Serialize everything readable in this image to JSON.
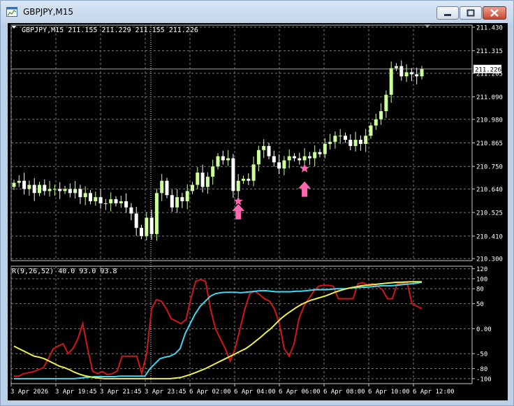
{
  "window": {
    "title": "GBPJPY,M15",
    "buttons": [
      "minimize",
      "maximize",
      "close"
    ]
  },
  "colors": {
    "background": "#000000",
    "grid": "#7a7a7a",
    "candle_bull": "#ccff99",
    "candle_bear": "#ffffff",
    "axis_text": "#ffffff",
    "rsi_red": "#d01818",
    "rsi_cyan": "#40d8f0",
    "rsi_yellow": "#f0f050",
    "signal_pink": "#ff66b0"
  },
  "chart_data": [
    {
      "type": "candlestick",
      "header": "GBPJPY,M15  211.155 211.229 211.155 211.226",
      "current_price_label": "211.226",
      "current_price": 211.226,
      "y_ticks": [
        "211.430",
        "211.315",
        "211.205",
        "211.090",
        "210.980",
        "210.865",
        "210.750",
        "210.640",
        "210.525",
        "210.410",
        "210.300"
      ],
      "ylim": [
        210.29,
        211.44
      ],
      "close": [
        210.67,
        210.68,
        210.64,
        210.66,
        210.62,
        210.66,
        210.63,
        210.64,
        210.64,
        210.63,
        210.64,
        210.62,
        210.64,
        210.6,
        210.62,
        210.58,
        210.6,
        210.57,
        210.57,
        210.59,
        210.57,
        210.58,
        210.55,
        210.52,
        210.45,
        210.41,
        210.5,
        210.42,
        210.62,
        210.68,
        210.61,
        210.55,
        210.6,
        210.58,
        210.63,
        210.66,
        210.72,
        210.65,
        210.7,
        210.75,
        210.8,
        210.78,
        210.79,
        210.63,
        210.68,
        210.69,
        210.68,
        210.76,
        210.83,
        210.85,
        210.8,
        210.77,
        210.74,
        210.78,
        210.8,
        210.79,
        210.78,
        210.8,
        210.79,
        210.82,
        210.81,
        210.86,
        210.87,
        210.9,
        210.9,
        210.88,
        210.85,
        210.88,
        210.86,
        210.9,
        210.95,
        210.98,
        211.02,
        211.1,
        211.23,
        211.24,
        211.19,
        211.21,
        211.2,
        211.19,
        211.226
      ],
      "signals": [
        {
          "type": "buy-arrow",
          "candle": 44,
          "price": 210.56
        },
        {
          "type": "star",
          "candle": 44,
          "price": 210.58
        },
        {
          "type": "buy-arrow",
          "candle": 57,
          "price": 210.67
        },
        {
          "type": "star",
          "candle": 57,
          "price": 210.74
        }
      ]
    },
    {
      "type": "line",
      "header": "R(9,26,52) 40.0 93.0 93.8",
      "y_ticks": [
        "120",
        "100",
        "80",
        "50",
        "0.00",
        "-50",
        "-80",
        "-100"
      ],
      "ylim": [
        -110,
        125
      ],
      "x_tick_labels": [
        "3 Apr 2026",
        "3 Apr 19:45",
        "3 Apr 21:45",
        "3 Apr 23:45",
        "6 Apr 02:00",
        "6 Apr 04:00",
        "6 Apr 06:00",
        "6 Apr 08:00",
        "6 Apr 10:00",
        "6 Apr 12:00"
      ],
      "series": [
        {
          "values": [
            -95,
            -95,
            -90,
            -88,
            -86,
            -82,
            -78,
            -60,
            -40,
            -35,
            -30,
            -50,
            -40,
            -20,
            10,
            -40,
            -85,
            -90,
            -86,
            -92,
            -90,
            -85,
            -55,
            -55,
            -55,
            -55,
            -90,
            -50,
            40,
            58,
            55,
            40,
            20,
            15,
            10,
            18,
            60,
            95,
            98,
            95,
            40,
            0,
            -20,
            -40,
            -65,
            -40,
            0,
            40,
            70,
            75,
            68,
            60,
            55,
            40,
            10,
            -40,
            -55,
            -30,
            20,
            45,
            60,
            75,
            85,
            87,
            87,
            85,
            60,
            60,
            60,
            60,
            90,
            92,
            88,
            90,
            85,
            78,
            60,
            60,
            90,
            90,
            93,
            50,
            45,
            40
          ]
        },
        {
          "values": [
            -100,
            -100,
            -100,
            -100,
            -100,
            -100,
            -100,
            -100,
            -100,
            -100,
            -100,
            -100,
            -100,
            -99,
            -98,
            -97,
            -96,
            -96,
            -96,
            -96,
            -96,
            -95,
            -95,
            -95,
            -95,
            -95,
            -95,
            -80,
            -70,
            -60,
            -57,
            -55,
            -50,
            -40,
            -10,
            10,
            30,
            45,
            55,
            65,
            70,
            72,
            73,
            73,
            73,
            72,
            73,
            74,
            75,
            76,
            76,
            75,
            74,
            74,
            74,
            74,
            75,
            75,
            76,
            77,
            78,
            78,
            78,
            79,
            80,
            80,
            80,
            82,
            82,
            83,
            83,
            84,
            85,
            86,
            86,
            86,
            87,
            88,
            89,
            90,
            91,
            93
          ]
        },
        {
          "values": [
            -35,
            -40,
            -45,
            -50,
            -55,
            -57,
            -60,
            -65,
            -70,
            -75,
            -78,
            -82,
            -87,
            -91,
            -94,
            -96,
            -98,
            -99,
            -100,
            -100,
            -100,
            -100,
            -100,
            -100,
            -100,
            -100,
            -100,
            -100,
            -100,
            -100,
            -100,
            -100,
            -99,
            -98,
            -95,
            -92,
            -88,
            -84,
            -80,
            -75,
            -70,
            -65,
            -60,
            -55,
            -50,
            -45,
            -40,
            -33,
            -25,
            -17,
            -8,
            0,
            10,
            20,
            28,
            35,
            42,
            48,
            53,
            57,
            60,
            63,
            66,
            70,
            74,
            77,
            80,
            82,
            84,
            86,
            87,
            88,
            89,
            90,
            91,
            92,
            93,
            93,
            93.5,
            94,
            94,
            93.8
          ]
        }
      ]
    }
  ]
}
